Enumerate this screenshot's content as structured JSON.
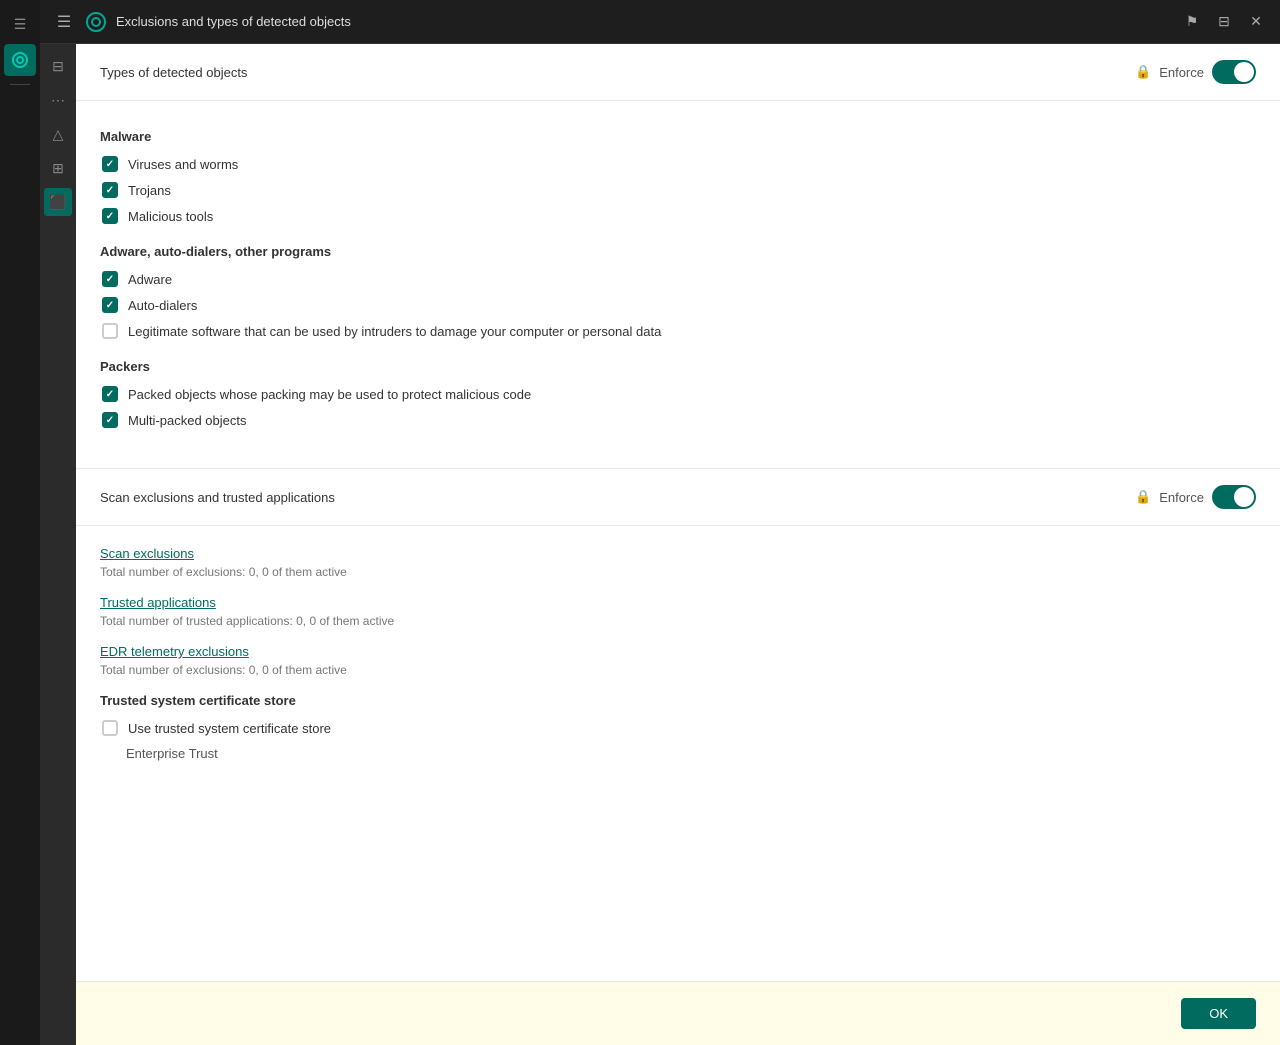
{
  "titleBar": {
    "title": "Exclusions and types of detected objects",
    "menuIcon": "☰",
    "flagIcon": "⚑",
    "bookIcon": "📖",
    "closeIcon": "✕"
  },
  "sections": {
    "typesOfDetectedObjects": {
      "title": "Types of detected objects",
      "enforceLabel": "Enforce",
      "toggleEnabled": true
    },
    "scanExclusions": {
      "title": "Scan exclusions and trusted applications",
      "enforceLabel": "Enforce",
      "toggleEnabled": true
    }
  },
  "malware": {
    "groupTitle": "Malware",
    "items": [
      {
        "label": "Viruses and worms",
        "checked": true
      },
      {
        "label": "Trojans",
        "checked": true
      },
      {
        "label": "Malicious tools",
        "checked": true
      }
    ]
  },
  "adware": {
    "groupTitle": "Adware, auto-dialers, other programs",
    "items": [
      {
        "label": "Adware",
        "checked": true
      },
      {
        "label": "Auto-dialers",
        "checked": true
      },
      {
        "label": "Legitimate software that can be used by intruders to damage your computer or personal data",
        "checked": false
      }
    ]
  },
  "packers": {
    "groupTitle": "Packers",
    "items": [
      {
        "label": "Packed objects whose packing may be used to protect malicious code",
        "checked": true
      },
      {
        "label": "Multi-packed objects",
        "checked": true
      }
    ]
  },
  "exclusions": {
    "scanExclusionsLink": "Scan exclusions",
    "scanExclusionsSub": "Total number of exclusions: 0, 0 of them active",
    "trustedApplicationsLink": "Trusted applications",
    "trustedApplicationsSub": "Total number of trusted applications: 0, 0 of them active",
    "edrLink": "EDR telemetry exclusions",
    "edrSub": "Total number of exclusions: 0, 0 of them active"
  },
  "trustedCertStore": {
    "groupTitle": "Trusted system certificate store",
    "checkboxLabel": "Use trusted system certificate store",
    "checked": false,
    "sublabel": "Enterprise Trust"
  },
  "bottomBar": {
    "okLabel": "OK"
  },
  "sidebar": {
    "icons": [
      "≡",
      "⬜",
      "△",
      "⊞",
      "⬛"
    ]
  }
}
